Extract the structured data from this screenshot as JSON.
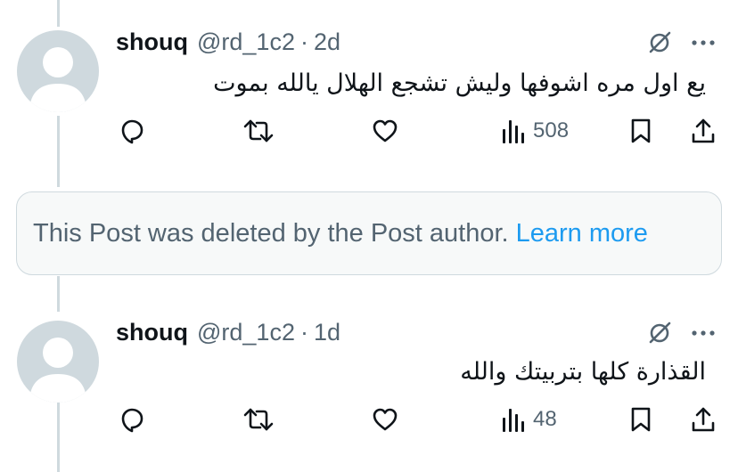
{
  "posts": [
    {
      "name": "shouq",
      "handle": "@rd_1c2",
      "separator": "·",
      "time": "2d",
      "text": "يع اول مره اشوفها وليش تشجع الهلال يالله بموت",
      "views": "508"
    },
    {
      "name": "shouq",
      "handle": "@rd_1c2",
      "separator": "·",
      "time": "1d",
      "text": "القذارة كلها بتربيتك والله",
      "views": "48"
    }
  ],
  "deleted_notice": {
    "text": "This Post was deleted by the Post author.",
    "link": "Learn more"
  },
  "colors": {
    "text": "#0f1419",
    "secondary": "#536471",
    "link": "#1d9bf0",
    "border": "#cfd9de",
    "notice_bg": "#f7f9f9"
  },
  "icons": [
    "reply-icon",
    "repost-icon",
    "like-icon",
    "views-icon",
    "bookmark-icon",
    "share-icon",
    "grok-icon",
    "more-icon"
  ]
}
